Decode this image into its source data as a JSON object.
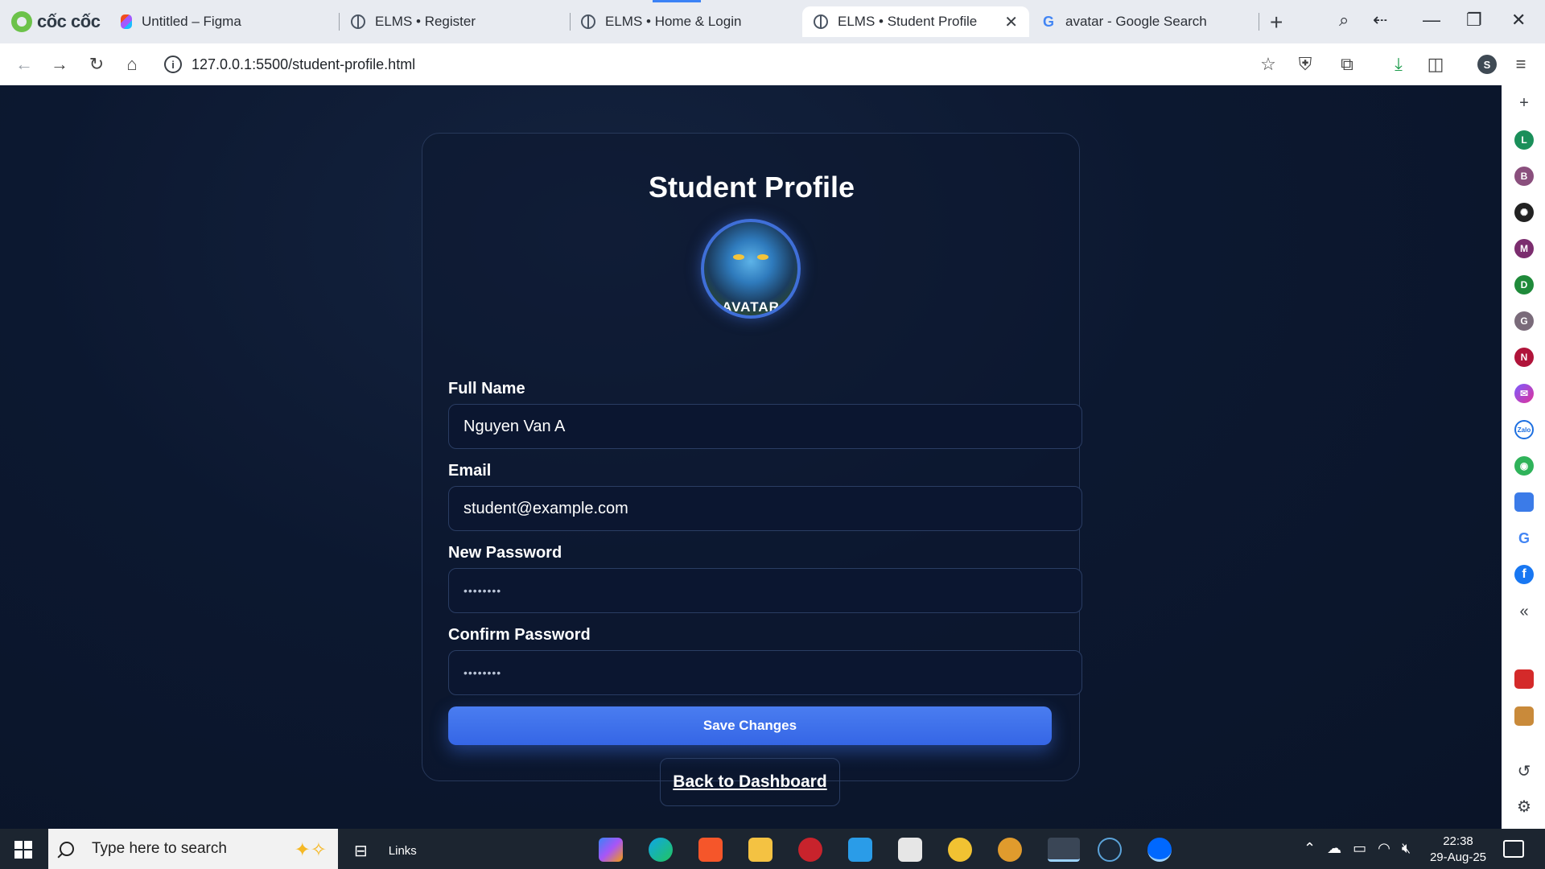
{
  "browser": {
    "brand": "cốc cốc",
    "tabs": [
      {
        "label": "Untitled – Figma",
        "icon": "figma-icon"
      },
      {
        "label": "ELMS • Register",
        "icon": "globe-icon"
      },
      {
        "label": "ELMS • Home & Login",
        "icon": "globe-icon"
      },
      {
        "label": "ELMS • Student Profile",
        "icon": "globe-icon",
        "active": true
      },
      {
        "label": "avatar - Google Search",
        "icon": "google-icon"
      }
    ],
    "url": "127.0.0.1:5500/student-profile.html",
    "profile_initial": "S"
  },
  "page": {
    "title": "Student Profile",
    "avatar_caption": "AVATAR",
    "fields": {
      "full_name": {
        "label": "Full Name",
        "value": "Nguyen Van A"
      },
      "email": {
        "label": "Email",
        "value": "student@example.com"
      },
      "new_password": {
        "label": "New Password",
        "value": "••••••••"
      },
      "confirm_password": {
        "label": "Confirm Password",
        "value": "••••••••"
      }
    },
    "save_label": "Save Changes",
    "back_label": "Back to Dashboard"
  },
  "sidebar": {
    "apps": [
      {
        "initial": "L",
        "color": "#1a8f5a"
      },
      {
        "initial": "B",
        "color": "#8a4f7d"
      },
      {
        "initial": "",
        "icon": "chatgpt-icon",
        "color": "#222222"
      },
      {
        "initial": "M",
        "color": "#7b2d6e"
      },
      {
        "initial": "D",
        "color": "#1f8a3a"
      },
      {
        "initial": "G",
        "color": "#7a6b7a"
      },
      {
        "initial": "N",
        "color": "#b0143a"
      }
    ]
  },
  "taskbar": {
    "search_placeholder": "Type here to search",
    "links_label": "Links",
    "time": "22:38",
    "date": "29-Aug-25"
  }
}
